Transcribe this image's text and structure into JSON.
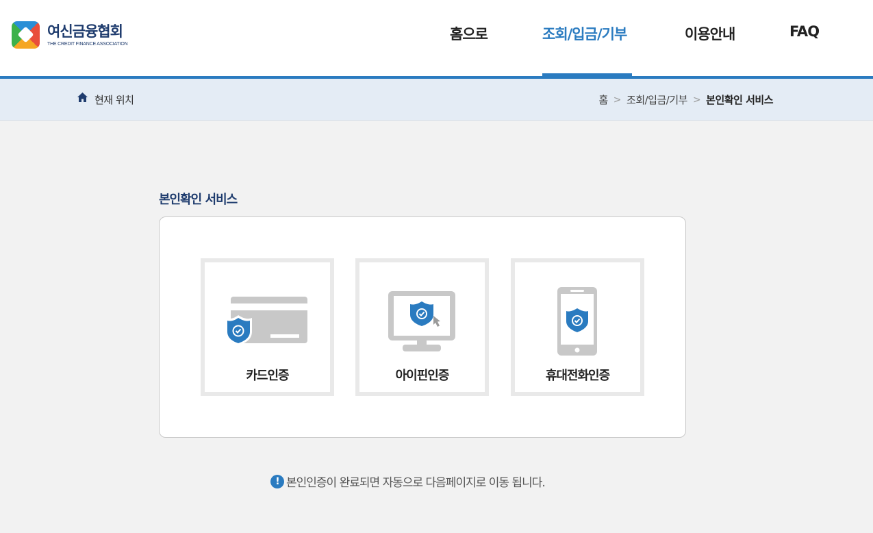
{
  "header": {
    "logo_title": "여신금융협회",
    "logo_subtitle": "THE CREDIT FINANCE ASSOCIATION",
    "nav": [
      {
        "label": "홈으로"
      },
      {
        "label": "조회/입금/기부",
        "active": true
      },
      {
        "label": "이용안내"
      },
      {
        "label": "FAQ"
      }
    ],
    "accent_color": "#2a7bc0"
  },
  "location": {
    "label": "현재 위치",
    "icon": "home-icon",
    "breadcrumbs": [
      "홈",
      "조회/입금/기부",
      "본인확인 서비스"
    ],
    "separator": ">"
  },
  "main": {
    "title": "본인확인 서비스",
    "options": [
      {
        "label": "카드인증",
        "icon": "credit-card-shield-icon"
      },
      {
        "label": "아이핀인증",
        "icon": "monitor-shield-icon"
      },
      {
        "label": "휴대전화인증",
        "icon": "mobile-shield-icon"
      }
    ],
    "notice": "본인인증이 완료되면 자동으로 다음페이지로 이동 됩니다.",
    "notice_icon": "exclamation-icon"
  }
}
